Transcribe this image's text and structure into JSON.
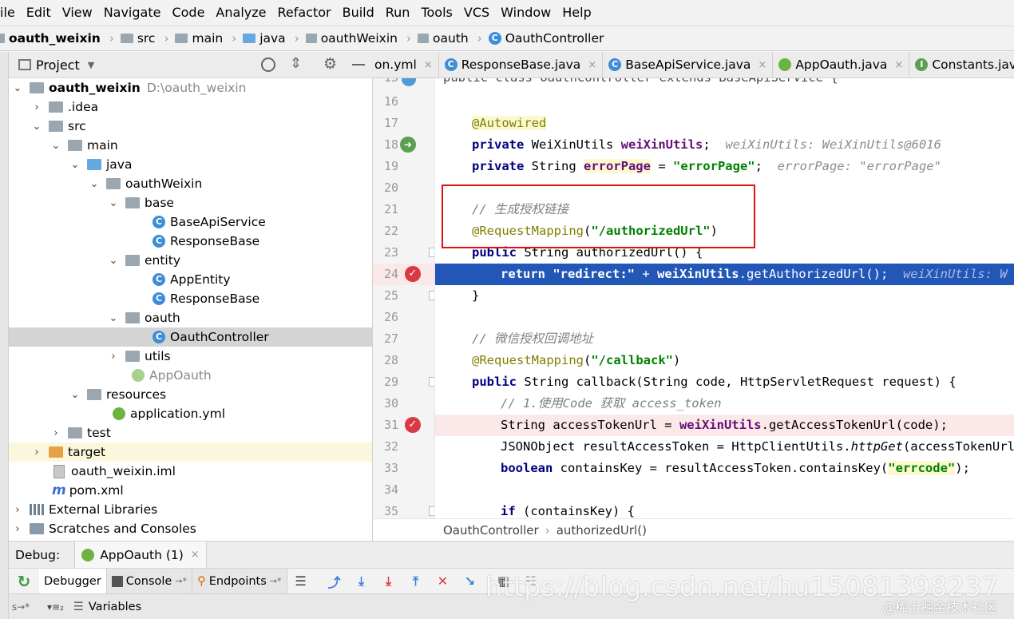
{
  "menu": [
    "ile",
    "Edit",
    "View",
    "Navigate",
    "Code",
    "Analyze",
    "Refactor",
    "Build",
    "Run",
    "Tools",
    "VCS",
    "Window",
    "Help"
  ],
  "breadcrumb": [
    "oauth_weixin",
    "src",
    "main",
    "java",
    "oauthWeixin",
    "oauth",
    "OauthController"
  ],
  "project_panel": {
    "title": "Project"
  },
  "tree": [
    {
      "label": "oauth_weixin",
      "extra": "D:\\oauth_weixin",
      "icon": "module"
    },
    {
      "label": ".idea",
      "icon": "folder"
    },
    {
      "label": "src",
      "icon": "folder"
    },
    {
      "label": "main",
      "icon": "folder"
    },
    {
      "label": "java",
      "icon": "source-folder"
    },
    {
      "label": "oauthWeixin",
      "icon": "package"
    },
    {
      "label": "base",
      "icon": "package"
    },
    {
      "label": "BaseApiService",
      "icon": "class"
    },
    {
      "label": "ResponseBase",
      "icon": "class"
    },
    {
      "label": "entity",
      "icon": "package"
    },
    {
      "label": "AppEntity",
      "icon": "class"
    },
    {
      "label": "ResponseBase",
      "icon": "class"
    },
    {
      "label": "oauth",
      "icon": "package"
    },
    {
      "label": "OauthController",
      "icon": "class"
    },
    {
      "label": "utils",
      "icon": "package"
    },
    {
      "label": "AppOauth",
      "icon": "spring-boot"
    },
    {
      "label": "resources",
      "icon": "resources-folder"
    },
    {
      "label": "application.yml",
      "icon": "spring-yml"
    },
    {
      "label": "test",
      "icon": "folder"
    },
    {
      "label": "target",
      "icon": "excluded-folder"
    },
    {
      "label": "oauth_weixin.iml",
      "icon": "iml-file"
    },
    {
      "label": "pom.xml",
      "icon": "maven"
    },
    {
      "label": "External Libraries",
      "icon": "libraries"
    },
    {
      "label": "Scratches and Consoles",
      "icon": "scratches"
    }
  ],
  "tabs": [
    {
      "label": "on.yml"
    },
    {
      "label": "ResponseBase.java"
    },
    {
      "label": "BaseApiService.java"
    },
    {
      "label": "AppOauth.java"
    },
    {
      "label": "Constants.java"
    }
  ],
  "code": {
    "line_numbers": [
      "16",
      "17",
      "18",
      "19",
      "20",
      "21",
      "22",
      "23",
      "24",
      "25",
      "26",
      "27",
      "28",
      "29",
      "30",
      "31",
      "32",
      "33",
      "34",
      "35"
    ],
    "partial_line": "public class OauthController extends BaseApiService {",
    "partial_line_number": "15",
    "l17_ann": "@Autowired",
    "l18_kw": "private",
    "l18_type": " WeiXinUtils ",
    "l18_field": "weiXinUtils",
    "l18_semi": ";",
    "l18_hint": "weiXinUtils: WeiXinUtils@6016",
    "l19_kw": "private",
    "l19_type": " String ",
    "l19_field": "errorPage",
    "l19_eq": " = ",
    "l19_str": "\"errorPage\"",
    "l19_semi": ";",
    "l19_hint": "errorPage: \"errorPage\"",
    "l21_cmt": "// 生成授权链接",
    "l22_ann": "@RequestMapping",
    "l22_open": "(",
    "l22_str": "\"/authorizedUrl\"",
    "l22_close": ")",
    "l23_kw": "public",
    "l23_rest": " String authorizedUrl() {",
    "l24_kw": "return",
    "l24_str": " \"redirect:\"",
    "l24_plus": " + ",
    "l24_field": "weiXinUtils",
    "l24_rest": ".getAuthorizedUrl();",
    "l24_hint": "weiXinUtils: W",
    "l25": "}",
    "l27_cmt": "// 微信授权回调地址",
    "l28_ann": "@RequestMapping",
    "l28_open": "(",
    "l28_str": "\"/callback\"",
    "l28_close": ")",
    "l29_kw": "public",
    "l29_rest": " String callback(String code, HttpServletRequest request) {",
    "l30_cmt": "// 1.使用Code 获取 access_token",
    "l31_pre": "String accessTokenUrl = ",
    "l31_field": "weiXinUtils",
    "l31_rest": ".getAccessTokenUrl(code);",
    "l32_pre": "JSONObject resultAccessToken = HttpClientUtils.",
    "l32_meth": "httpGet",
    "l32_rest": "(accessTokenUrl);",
    "l33_kw": "boolean",
    "l33_pre": " containsKey = resultAccessToken.containsKey(",
    "l33_str": "\"errcode\"",
    "l33_rest": ");",
    "l35_kw": "if",
    "l35_rest": " (containsKey) {"
  },
  "editor_breadcrumb": [
    "OauthController",
    "authorizedUrl()"
  ],
  "debug": {
    "label": "Debug:",
    "session": "AppOauth (1)",
    "tabs": [
      "Debugger",
      "Console",
      "Endpoints"
    ],
    "variables_label": "Variables"
  },
  "watermark": "https://blog.csdn.net/hu15081398237",
  "watermark2": "@稀土掘金技术社区",
  "colors": {
    "selection": "#2257b8",
    "breakpoint": "#d93943",
    "highlight_box": "#e01010"
  }
}
